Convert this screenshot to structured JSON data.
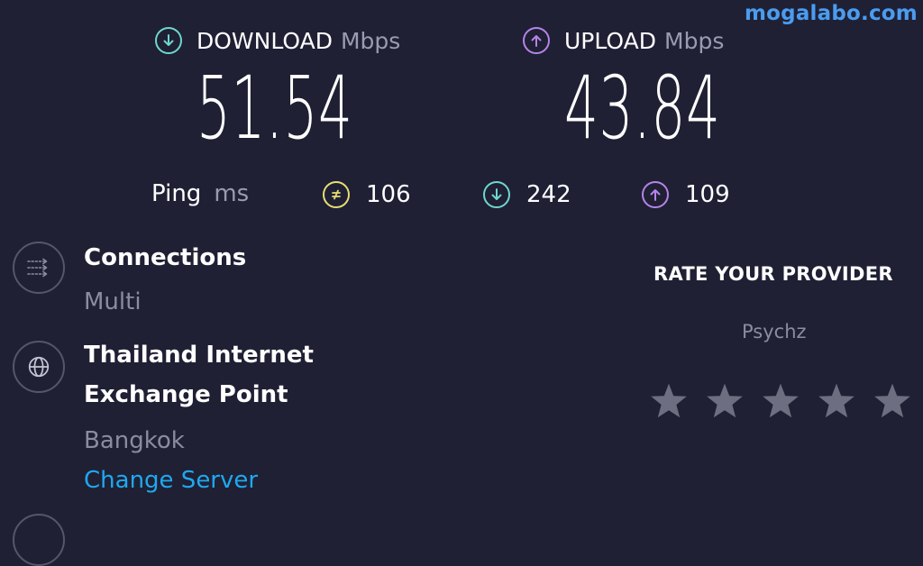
{
  "watermark": "mogalabo.com",
  "download": {
    "label": "DOWNLOAD",
    "unit": "Mbps",
    "value": "51.54",
    "color": "#6fd6d0"
  },
  "upload": {
    "label": "UPLOAD",
    "unit": "Mbps",
    "value": "43.84",
    "color": "#b584e8"
  },
  "ping": {
    "label": "Ping",
    "unit": "ms",
    "idle": {
      "value": "106",
      "color": "#e8de72"
    },
    "download": {
      "value": "242",
      "color": "#6fd6d0"
    },
    "upload": {
      "value": "109",
      "color": "#b584e8"
    }
  },
  "connections": {
    "title": "Connections",
    "value": "Multi"
  },
  "server": {
    "title_line1": "Thailand Internet",
    "title_line2": "Exchange Point",
    "location": "Bangkok",
    "change_label": "Change Server"
  },
  "rating": {
    "title": "RATE YOUR PROVIDER",
    "provider": "Psychz",
    "stars_total": 5,
    "stars_selected": 0,
    "star_color": "#6d6e80"
  }
}
